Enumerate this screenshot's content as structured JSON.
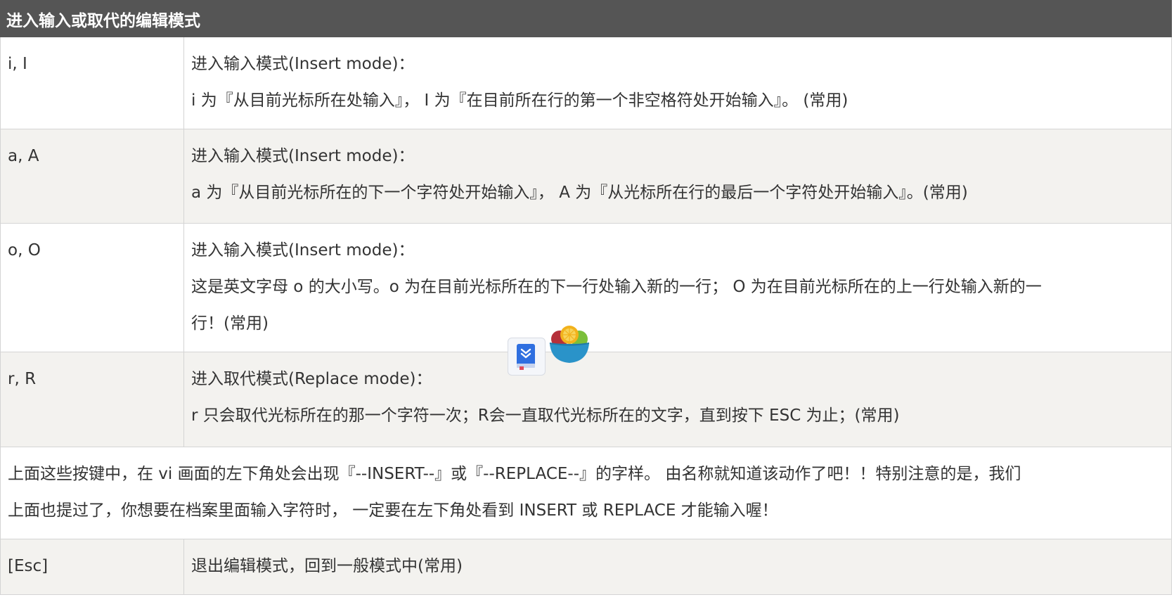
{
  "header": {
    "title": "进入输入或取代的编辑模式"
  },
  "rows": [
    {
      "key": "i, I",
      "lines": [
        "进入输入模式(Insert mode)：",
        "i 为『从目前光标所在处输入』， I 为『在目前所在行的第一个非空格符处开始输入』。 (常用)"
      ]
    },
    {
      "key": "a, A",
      "lines": [
        "进入输入模式(Insert mode)：",
        "a 为『从目前光标所在的下一个字符处开始输入』， A 为『从光标所在行的最后一个字符处开始输入』。(常用)"
      ]
    },
    {
      "key": "o, O",
      "lines": [
        "进入输入模式(Insert mode)：",
        "这是英文字母 o 的大小写。o 为在目前光标所在的下一行处输入新的一行； O 为在目前光标所在的上一行处输入新的一",
        "行！(常用)"
      ]
    },
    {
      "key": "r, R",
      "lines": [
        "进入取代模式(Replace mode)：",
        "r 只会取代光标所在的那一个字符一次；R会一直取代光标所在的文字，直到按下 ESC 为止；(常用)"
      ]
    }
  ],
  "note": {
    "lines": [
      "上面这些按键中，在 vi 画面的左下角处会出现『--INSERT--』或『--REPLACE--』的字样。 由名称就知道该动作了吧！！特别注意的是，我们",
      "上面也提过了，你想要在档案里面输入字符时， 一定要在左下角处看到 INSERT 或 REPLACE 才能输入喔！"
    ]
  },
  "esc_row": {
    "key": "[Esc]",
    "desc": "退出编辑模式，回到一般模式中(常用)"
  },
  "overlay": {
    "book_icon": "bookmark-book-icon",
    "bowl_icon": "fruit-bowl-icon"
  },
  "colors": {
    "header_bg": "#555555",
    "row_alt_bg": "#f3f2ef",
    "border": "#d4d4d4"
  }
}
